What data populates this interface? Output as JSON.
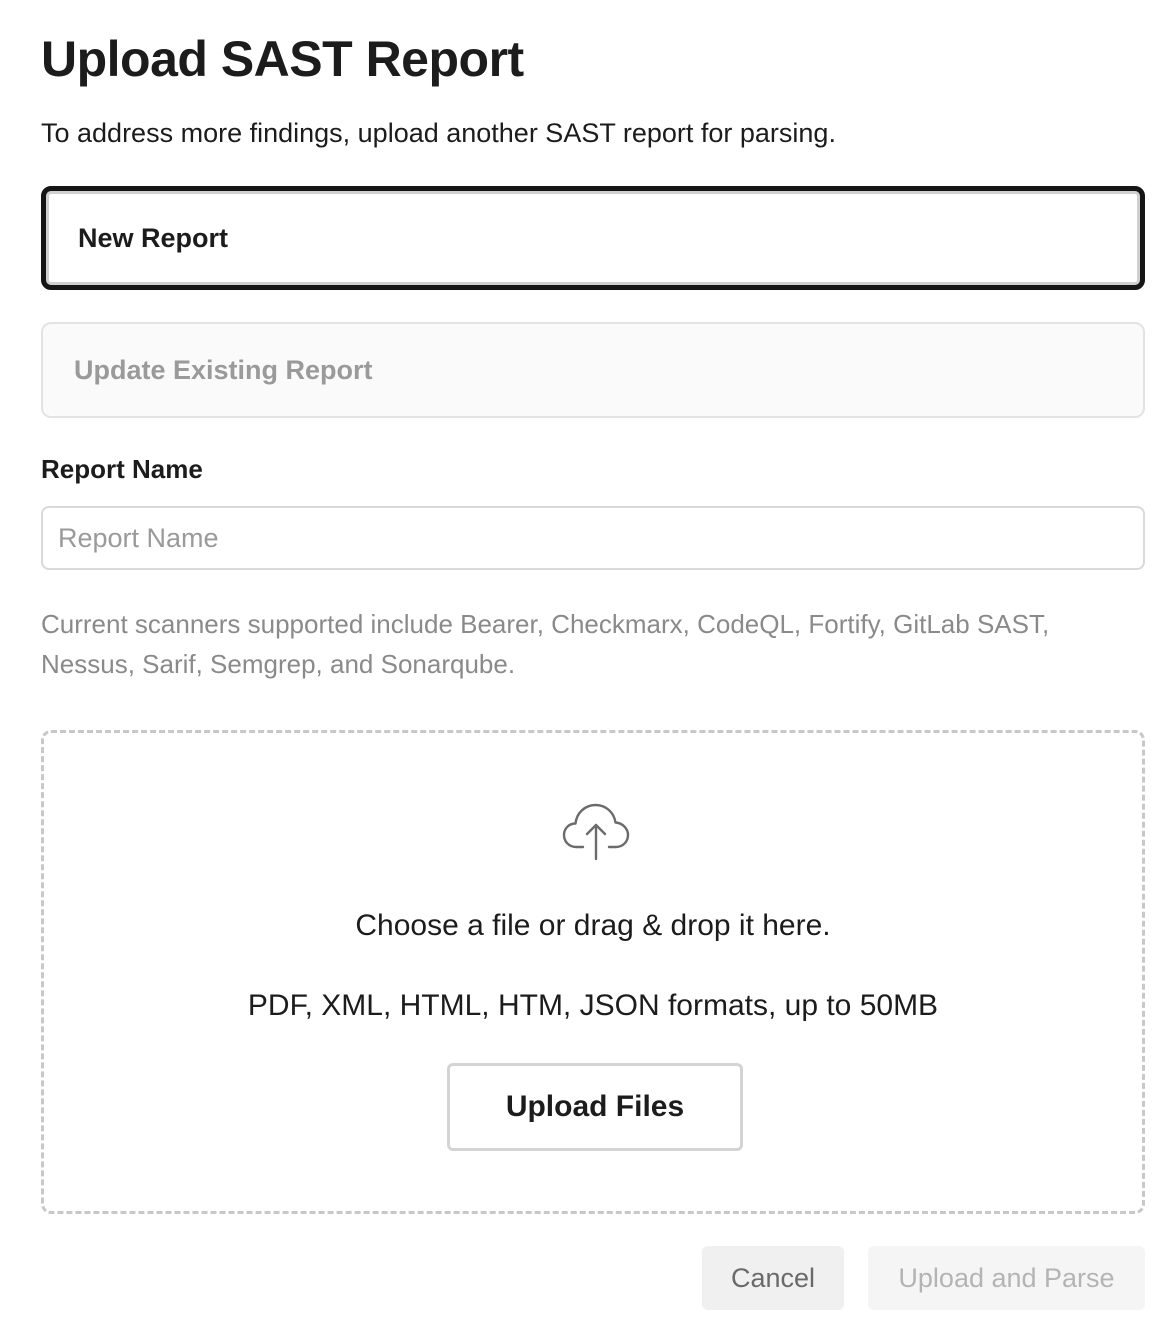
{
  "dialog": {
    "title": "Upload SAST Report",
    "subtitle": "To address more findings, upload another SAST report for parsing."
  },
  "report_type": {
    "selected": "new",
    "options": [
      {
        "id": "new",
        "label": "New Report"
      },
      {
        "id": "update",
        "label": "Update Existing Report"
      }
    ]
  },
  "report_name": {
    "label": "Report Name",
    "placeholder": "Report Name",
    "value": ""
  },
  "scanners_note": "Current scanners supported include Bearer, Checkmarx, CodeQL, Fortify, GitLab SAST, Nessus, Sarif, Semgrep, and Sonarqube.",
  "dropzone": {
    "icon": "cloud-upload-icon",
    "primary_text": "Choose a file or drag & drop it here.",
    "formats_text": "PDF, XML, HTML, HTM, JSON formats, up to 50MB",
    "button_label": "Upload Files"
  },
  "footer": {
    "cancel_label": "Cancel",
    "submit_label": "Upload and Parse"
  },
  "colors": {
    "text_primary": "#1c1c1c",
    "text_muted": "#8a8a8a",
    "selected_border": "#161616",
    "disabled_text": "#b4b4b4"
  }
}
